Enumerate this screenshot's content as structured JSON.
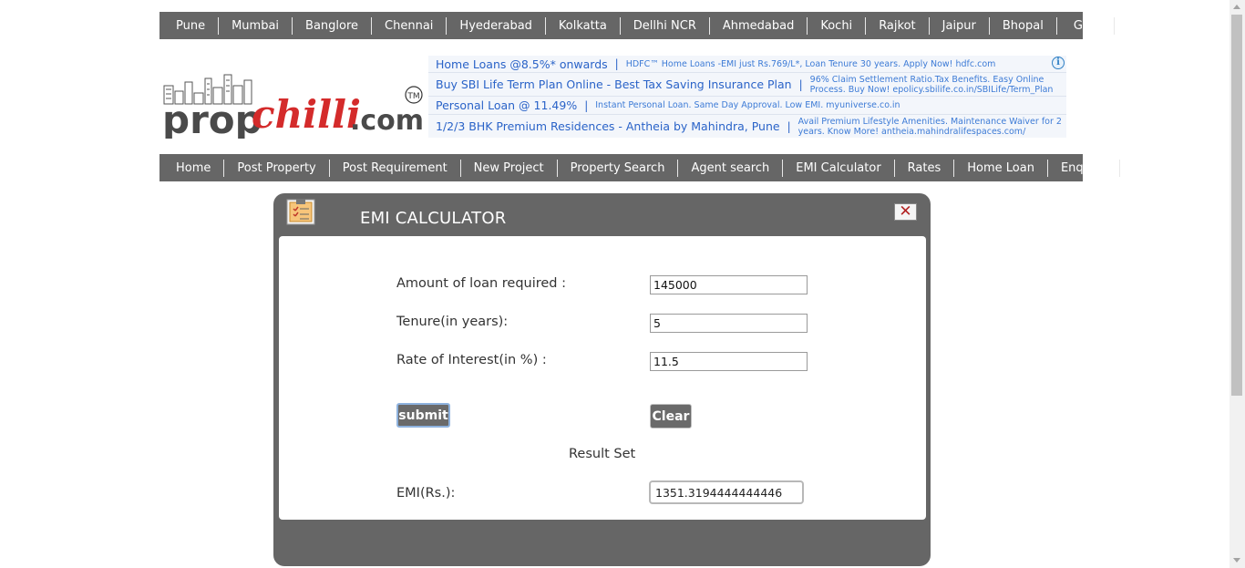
{
  "cities": [
    "Pune",
    "Mumbai",
    "Banglore",
    "Chennai",
    "Hyederabad",
    "Kolkatta",
    "Dellhi NCR",
    "Ahmedabad",
    "Kochi",
    "Rajkot",
    "Jaipur",
    "Bhopal",
    "Goa"
  ],
  "logo": {
    "text_prop": "prop",
    "text_chilli": "chilli",
    "text_com": ".com",
    "tm": "TM"
  },
  "ads": [
    {
      "title": "Home Loans @8.5%* onwards",
      "desc": "HDFC™ Home Loans -EMI just Rs.769/L*, Loan Tenure 30 years. Apply Now! hdfc.com"
    },
    {
      "title": "Buy SBI Life Term Plan Online - Best Tax Saving Insurance Plan",
      "desc": "96% Claim Settlement Ratio.Tax Benefits. Easy Online Process. Buy Now! epolicy.sbilife.co.in/SBILife/Term_Plan"
    },
    {
      "title": "Personal Loan @ 11.49%",
      "desc": "Instant Personal Loan. Same Day Approval. Low EMI. myuniverse.co.in"
    },
    {
      "title": "1/2/3 BHK Premium Residences - Antheia by Mahindra, Pune",
      "desc": "Avail Premium Lifestyle Amenities. Maintenance Waiver for 2 years. Know More! antheia.mahindralifespaces.com/"
    }
  ],
  "ads_info_icon": "i",
  "nav": [
    "Home",
    "Post Property",
    "Post Requirement",
    "New Project",
    "Property Search",
    "Agent search",
    "EMI Calculator",
    "Rates",
    "Home Loan",
    "Enquiry"
  ],
  "modal": {
    "title": "EMI CALCULATOR",
    "close_symbol": "✕",
    "loan_label": "Amount of loan required :",
    "loan_value": "145000",
    "tenure_label": "Tenure(in years):",
    "tenure_value": "5",
    "rate_label": "Rate of Interest(in %) :",
    "rate_value": "11.5",
    "submit_label": "submit",
    "clear_label": "Clear",
    "result_heading": "Result Set",
    "emi_label": "EMI(Rs.):",
    "emi_value": "1351.3194444444446"
  }
}
